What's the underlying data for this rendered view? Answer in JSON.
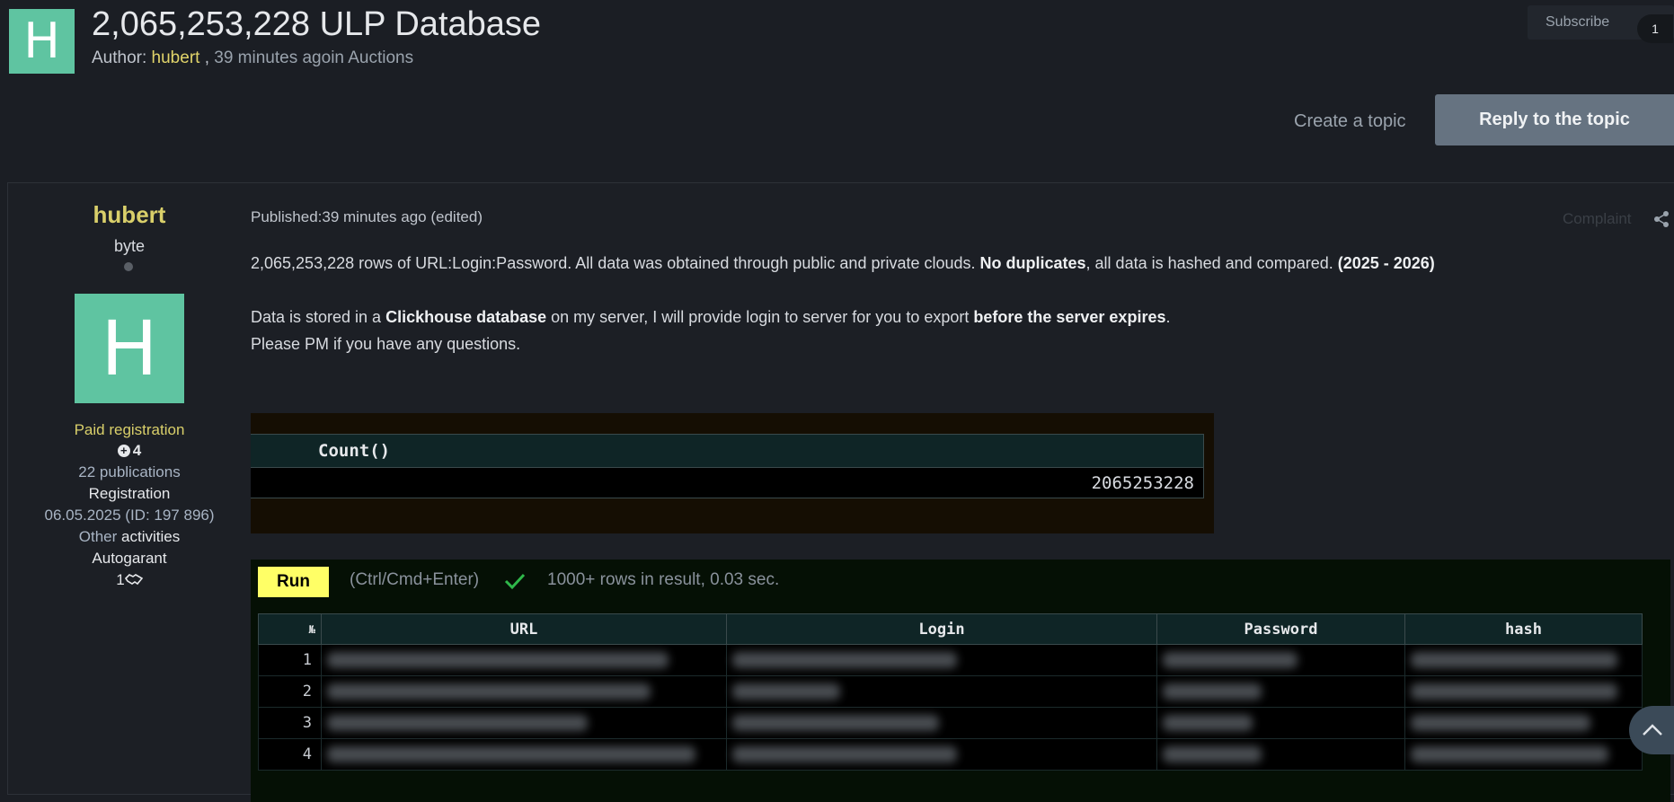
{
  "topic": {
    "avatar_letter": "H",
    "title": "2,065,253,228 ULP Database",
    "author_label": "Author: ",
    "author": "hubert",
    "sep": " , ",
    "time": "39 minutes ago",
    "in_label": "in ",
    "category": "Auctions"
  },
  "subscribe": {
    "label": "Subscribe",
    "count": "1"
  },
  "actions": {
    "create_topic": "Create a topic",
    "reply": "Reply to the topic"
  },
  "sidebar": {
    "name": "hubert",
    "rank": "byte",
    "avatar_letter": "H",
    "paid": "Paid registration",
    "reputation": "4",
    "publications": "22 publications",
    "registration_label": "Registration",
    "registration_value": "06.05.2025 (ID: 197 896)",
    "other": "Other",
    "activities": " activities",
    "autogarant": "Autogarant",
    "deals": "1"
  },
  "post": {
    "published": "Published:39 minutes ago (edited)",
    "complaint": "Complaint",
    "p1_a": "2,065,253,228 rows of URL:Login:Password. All data was obtained through public and private clouds. ",
    "p1_b": "No duplicates",
    "p1_c": ", all data is hashed and compared. ",
    "p1_d": "(2025 - 2026)",
    "p2_a": "Data is stored in a ",
    "p2_b": "Clickhouse database",
    "p2_c": " on my server, I will provide login to server for you to export ",
    "p2_d": "before the server expires",
    "p2_e": ".",
    "p3": "Please PM if you have any questions."
  },
  "count_box": {
    "header": "Count()",
    "value": "2065253228"
  },
  "result": {
    "run": "Run",
    "shortcut": "(Ctrl/Cmd+Enter)",
    "info": "1000+ rows in result, 0.03 sec.",
    "columns": [
      "№",
      "URL",
      "Login",
      "Password",
      "hash"
    ],
    "rows": [
      "1",
      "2",
      "3",
      "4"
    ]
  },
  "colors": {
    "accent": "#5fc4a1",
    "author": "#d9cf6a",
    "reply_button": "#667381",
    "run_button": "#ffff66"
  }
}
